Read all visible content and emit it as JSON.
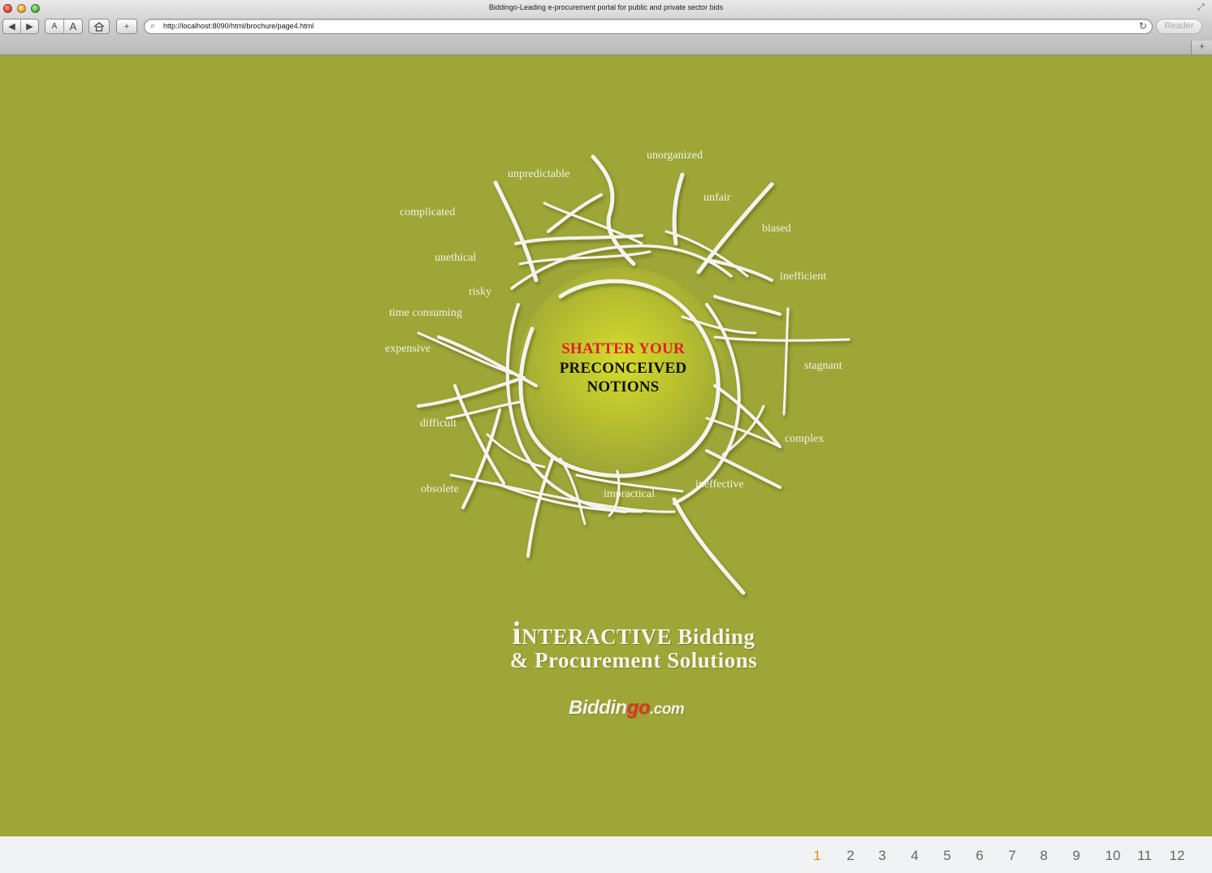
{
  "browser": {
    "window_title": "Biddingo-Leading e-procurement portal for public and private sector bids",
    "url": "http://localhost:8090/html/brochure/page4.html",
    "reader_label": "Reader",
    "font_small_label": "A",
    "font_large_label": "A"
  },
  "artwork": {
    "words": [
      "unorganized",
      "unpredictable",
      "unfair",
      "complicated",
      "biased",
      "unethical",
      "inefficient",
      "risky",
      "time consuming",
      "expensive",
      "stagnant",
      "difficult",
      "complex",
      "ineffective",
      "obsolete",
      "impractical"
    ],
    "headline_line1": "SHATTER YOUR",
    "headline_line2": "PRECONCEIVED",
    "headline_line3": "NOTIONS"
  },
  "tagline": {
    "initial": "i",
    "line1_rest": "NTERACTIVE Bidding",
    "line2": "& Procurement Solutions"
  },
  "logo": {
    "part1": "Biddin",
    "part2": "go",
    "part3": ".com"
  },
  "pagination": {
    "active_page": "1",
    "pages": [
      "1",
      "2",
      "3",
      "4",
      "5",
      "6",
      "7",
      "8",
      "9",
      "10",
      "11",
      "12"
    ]
  },
  "colors": {
    "page_background": "#9ea637",
    "headline_red": "#e0211f",
    "active_page": "#e58a1e"
  }
}
